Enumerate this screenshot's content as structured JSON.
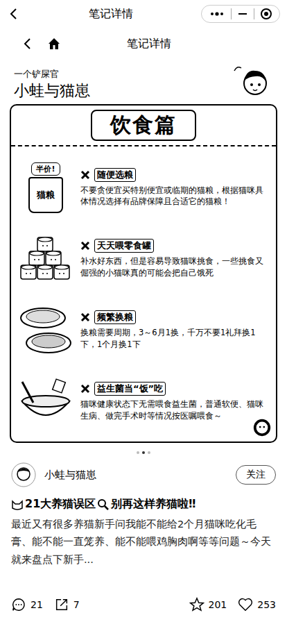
{
  "miniapp_bar": {
    "title": "笔记详情"
  },
  "nav": {
    "title": "笔记详情"
  },
  "poster": {
    "tagline": "一个铲屎官",
    "brand": "小蛙与猫崽",
    "heading": "饮食篇",
    "bag_tag": "半价!",
    "bag_label": "猫粮",
    "items": [
      {
        "title": "随便选粮",
        "desc": "不要贪便宜买特别便宜或临期的猫粮，根据猫咪具体情况选择有品牌保障且合适它的猫粮！",
        "kind": "bag"
      },
      {
        "title": "天天喂零食罐",
        "desc": "补水好东西，但是容易导致猫咪挑食，一些挑食又倔强的小猫咪真的可能会把自己饿死",
        "kind": "cans"
      },
      {
        "title": "频繁换粮",
        "desc": "换粮需要周期，3～6月1换，千万不要1礼拜换1下，1个月换1下",
        "kind": "bowls"
      },
      {
        "title": "益生菌当“饭”吃",
        "desc": "猫咪健康状态下无需喂食益生菌，普通软便、猫咪生病、做完手术时等情况按医嘱喂食～",
        "kind": "spoon"
      }
    ]
  },
  "carousel": {
    "dots": [
      {
        "selected": false
      },
      {
        "selected": true
      },
      {
        "selected": false
      }
    ]
  },
  "author": {
    "name": "小蛙与猫崽",
    "follow": "关注"
  },
  "note": {
    "title": "21大养猫误区",
    "title_tail": "别再这样养猫啦‼",
    "body": "最近又有很多养猫新手问我能不能给2个月猫咪吃化毛膏、能不能一直笼养、能不能喂鸡胸肉啊等等问题～今天就来盘点下新手..."
  },
  "actions": [
    {
      "kind": "comment",
      "count": "21"
    },
    {
      "kind": "share",
      "count": "7"
    },
    {
      "kind": "star",
      "count": "201"
    },
    {
      "kind": "like",
      "count": "253"
    }
  ]
}
